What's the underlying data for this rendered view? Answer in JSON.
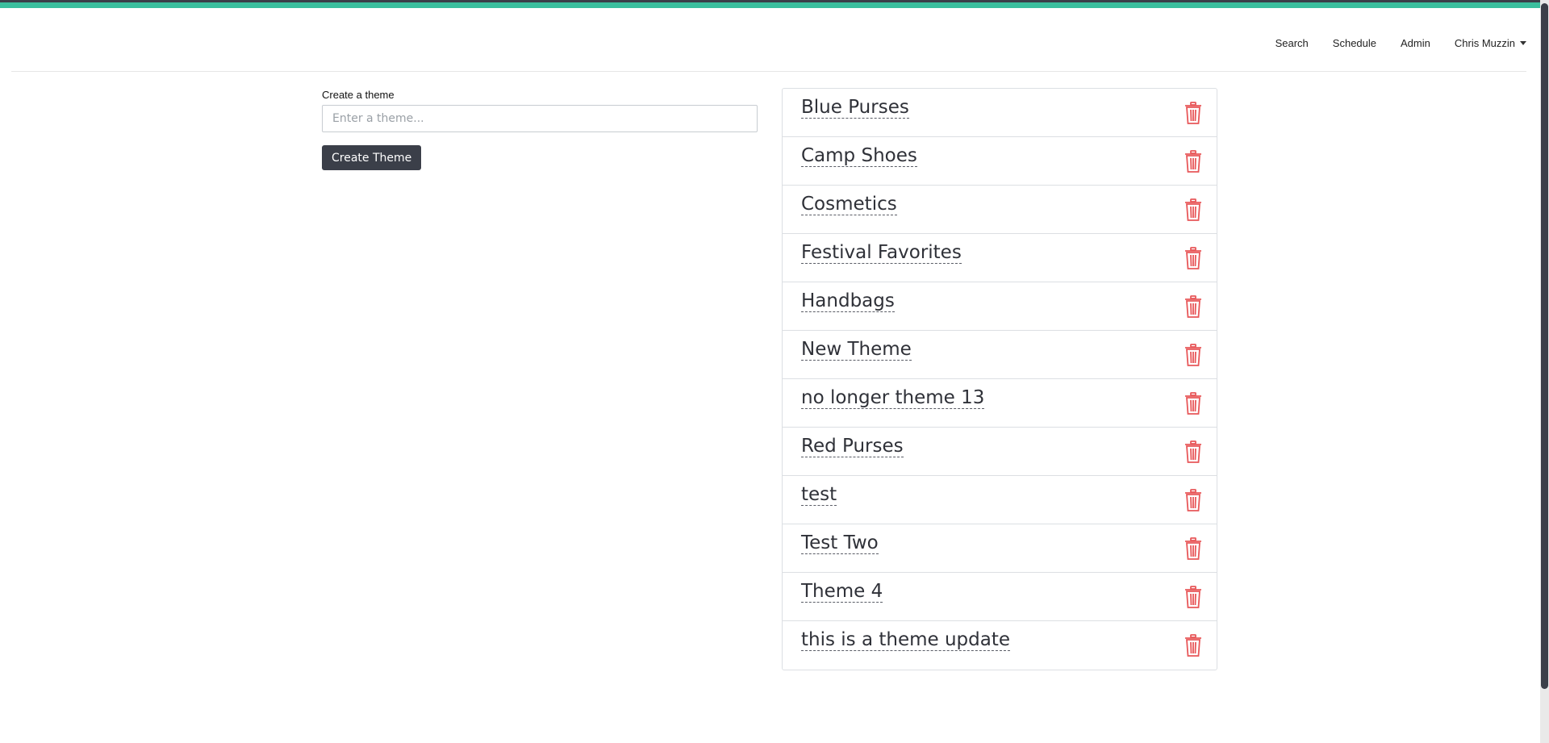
{
  "colors": {
    "accent": "#3bbf9e",
    "dark": "#3b3f49",
    "delete": "#e8585a"
  },
  "nav": {
    "items": [
      {
        "label": "Search"
      },
      {
        "label": "Schedule"
      },
      {
        "label": "Admin"
      }
    ],
    "user": {
      "label": "Chris Muzzin",
      "icon": "caret-down-icon"
    }
  },
  "create": {
    "label": "Create a theme",
    "placeholder": "Enter a theme...",
    "value": "",
    "button_label": "Create Theme"
  },
  "themes": [
    {
      "name": "Blue Purses"
    },
    {
      "name": "Camp Shoes"
    },
    {
      "name": "Cosmetics"
    },
    {
      "name": "Festival Favorites"
    },
    {
      "name": "Handbags"
    },
    {
      "name": "New Theme"
    },
    {
      "name": "no longer theme 13"
    },
    {
      "name": "Red Purses"
    },
    {
      "name": "test"
    },
    {
      "name": "Test Two"
    },
    {
      "name": "Theme 4"
    },
    {
      "name": "this is a theme update"
    }
  ]
}
